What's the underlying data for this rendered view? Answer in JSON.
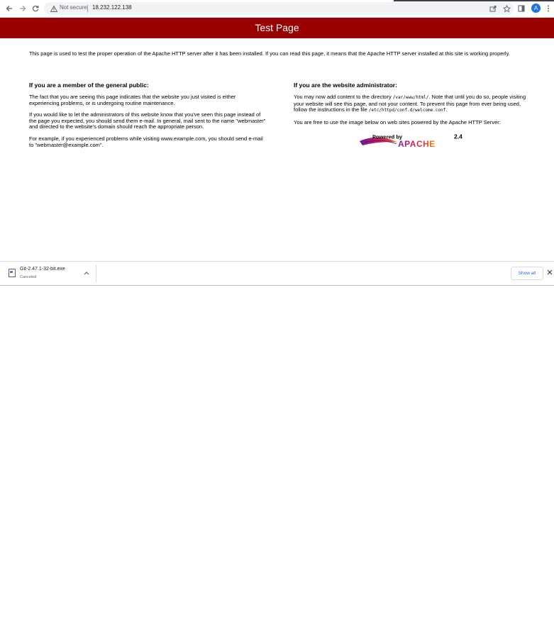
{
  "browser": {
    "security_label": "Not secure",
    "url": "18.232.122.138",
    "profile_initial": "A"
  },
  "page": {
    "title": "Test Page",
    "intro": "This page is used to test the proper operation of the Apache HTTP server after it has been installed. If you can read this page, it means that the Apache HTTP server installed at this site is working properly.",
    "public": {
      "heading": "If you are a member of the general public:",
      "p1": "The fact that you are seeing this page indicates that the website you just visited is either experiencing problems, or is undergoing routine maintenance.",
      "p2": "If you would like to let the administrators of this website know that you've seen this page instead of the page you expected, you should send them e-mail. In general, mail sent to the name \"webmaster\" and directed to the website's domain should reach the appropriate person.",
      "p3": "For example, if you experienced problems while visiting www.example.com, you should send e-mail to \"webmaster@example.com\"."
    },
    "admin": {
      "heading": "If you are the website administrator:",
      "p1_a": "You may now add content to the directory ",
      "p1_code1": "/var/www/html/",
      "p1_b": ". Note that until you do so, people visiting your website will see this page, and not your content. To prevent this page from ever being used, follow the instructions in the file ",
      "p1_code2": "/etc/httpd/conf.d/welcome.conf",
      "p1_c": ".",
      "p2": "You are free to use the image below on web sites powered by the Apache HTTP Server:"
    },
    "logo": {
      "powered_by": "Powered by",
      "name": "APACHE",
      "version": "2.4"
    }
  },
  "downloads": {
    "file_name": "Git-2.47.1-32-bit.exe",
    "status": "Canceled",
    "show_all_label": "Show all"
  },
  "colors": {
    "banner": "#990000",
    "link_blue": "#1a73e8"
  }
}
